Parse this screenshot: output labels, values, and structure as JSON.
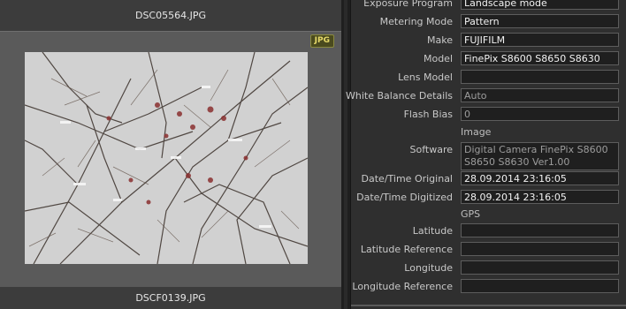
{
  "browser": {
    "top_filename": "DSC05564.JPG",
    "badge": "JPG",
    "bottom_filename": "DSCF0139.JPG"
  },
  "metadata": {
    "rows": [
      {
        "label": "Exposure Program",
        "value": "Landscape mode"
      },
      {
        "label": "Metering Mode",
        "value": "Pattern"
      },
      {
        "label": "Make",
        "value": "FUJIFILM"
      },
      {
        "label": "Model",
        "value": "FinePix S8600 S8650 S8630"
      },
      {
        "label": "Lens Model",
        "value": ""
      },
      {
        "label": "White Balance Details",
        "value": "Auto"
      },
      {
        "label": "Flash Bias",
        "value": "0"
      }
    ],
    "section_image": "Image",
    "software_label": "Software",
    "software_value": "Digital Camera FinePix S8600 S8650 S8630 Ver1.00",
    "dt_original_label": "Date/Time Original",
    "dt_original_value": "28.09.2014 23:16:05",
    "dt_digitized_label": "Date/Time Digitized",
    "dt_digitized_value": "28.09.2014 23:16:05",
    "section_gps": "GPS",
    "gps_rows": [
      {
        "label": "Latitude",
        "value": ""
      },
      {
        "label": "Latitude Reference",
        "value": ""
      },
      {
        "label": "Longitude",
        "value": ""
      },
      {
        "label": "Longitude Reference",
        "value": ""
      }
    ]
  }
}
